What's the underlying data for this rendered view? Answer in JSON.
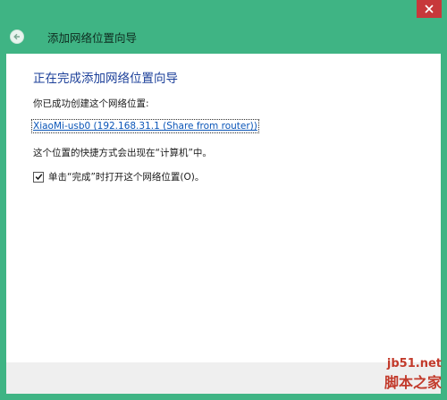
{
  "window": {
    "header_title": "添加网络位置向导",
    "close_icon": "close-icon",
    "back_icon": "back-arrow-icon"
  },
  "content": {
    "heading": "正在完成添加网络位置向导",
    "created_text": "你已成功创建这个网络位置:",
    "location_link": "XiaoMi-usb0 (192.168.31.1 (Share from router))",
    "shortcut_text": "这个位置的快捷方式会出现在“计算机”中。",
    "open_checkbox": {
      "label": "单击“完成”时打开这个网络位置(O)。",
      "checked": true
    }
  },
  "watermark": {
    "line1": "jb51.net",
    "line2": "脚本之家"
  },
  "colors": {
    "frame": "#3fb484",
    "heading": "#1b3f99",
    "link": "#0a55b8",
    "close": "#c7383b"
  }
}
